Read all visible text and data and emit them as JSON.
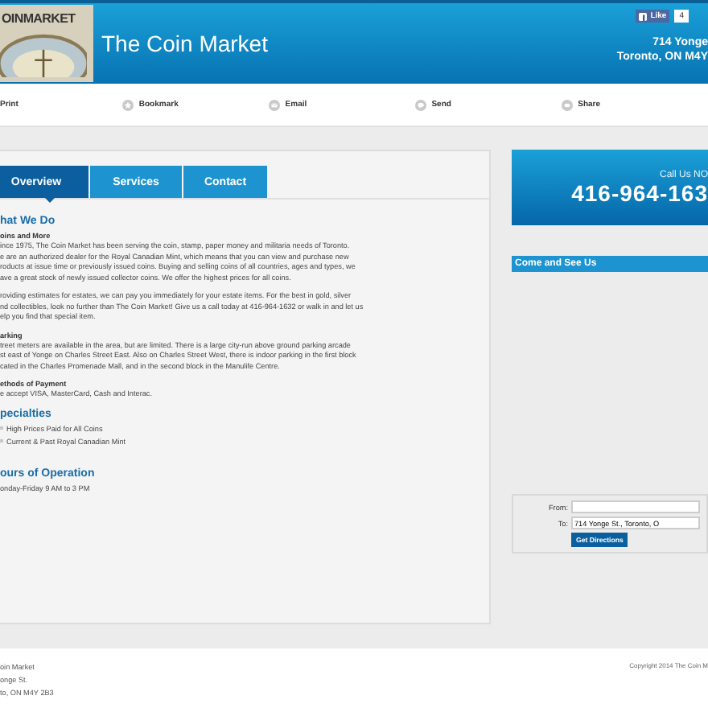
{
  "header": {
    "logo_text": "OINMARKET",
    "title": "The Coin Market",
    "like": {
      "label": "Like",
      "count": "4"
    },
    "address": [
      "714 Yonge",
      "Toronto, ON M4Y"
    ]
  },
  "toolbar": [
    {
      "label": "Print",
      "kind": "none"
    },
    {
      "label": "Bookmark",
      "kind": "star"
    },
    {
      "label": "Email",
      "kind": "envelope"
    },
    {
      "label": "Send",
      "kind": "bubble"
    },
    {
      "label": "Share",
      "kind": "chat"
    }
  ],
  "tabs": [
    {
      "label": "Overview",
      "selected": true
    },
    {
      "label": "Services",
      "selected": false
    },
    {
      "label": "Contact",
      "selected": false
    }
  ],
  "sections": [
    {
      "heading": "hat We Do",
      "blocks": [
        {
          "subheading": "oins and More",
          "paragraphs": [
            [
              "ince 1975, The Coin Market has been serving the coin, stamp, paper money and militaria needs of Toronto.",
              "e are an authorized dealer for the Royal Canadian Mint, which means that you can view and purchase new",
              "roducts at issue time or previously issued coins. Buying and selling coins of all countries, ages and types, we",
              "ave a great stock of newly issued collector coins. We offer the highest prices for all coins."
            ],
            [
              "roviding estimates for estates, we can pay you immediately for your estate items. For the best in gold, silver",
              "nd collectibles, look no further than The Coin Market! Give us a call today at 416-964-1632 or walk in and let us",
              "elp you find that special item."
            ]
          ]
        },
        {
          "subheading": "arking",
          "paragraphs": [
            [
              "treet meters are available in the area, but are limited. There is a large city-run above ground parking arcade",
              "st east of Yonge on Charles Street East. Also on Charles Street West, there is indoor parking in the first block",
              "cated in the Charles Promenade Mall, and in the second block in the Manulife Centre."
            ]
          ]
        },
        {
          "subheading": "ethods of Payment",
          "paragraphs": [
            [
              "e accept VISA, MasterCard, Cash and Interac."
            ]
          ]
        }
      ]
    },
    {
      "heading": "pecialties",
      "items": [
        "High Prices Paid for All Coins",
        "Current & Past Royal Canadian Mint"
      ]
    },
    {
      "heading": "ours of Operation",
      "lines": [
        "onday-Friday 9 AM to 3 PM"
      ]
    }
  ],
  "sidebar": {
    "call_label": "Call Us NO",
    "phone": "416-964-163",
    "map_title": "Come and See Us",
    "directions": {
      "from_label": "From:",
      "to_label": "To:",
      "to_value": "714 Yonge St., Toronto, O",
      "button": "Get Directions"
    }
  },
  "footer": {
    "address": [
      "oin Market",
      "onge St.",
      "to, ON M4Y 2B3"
    ],
    "copyright": "Copyright 2014 The Coin M"
  }
}
